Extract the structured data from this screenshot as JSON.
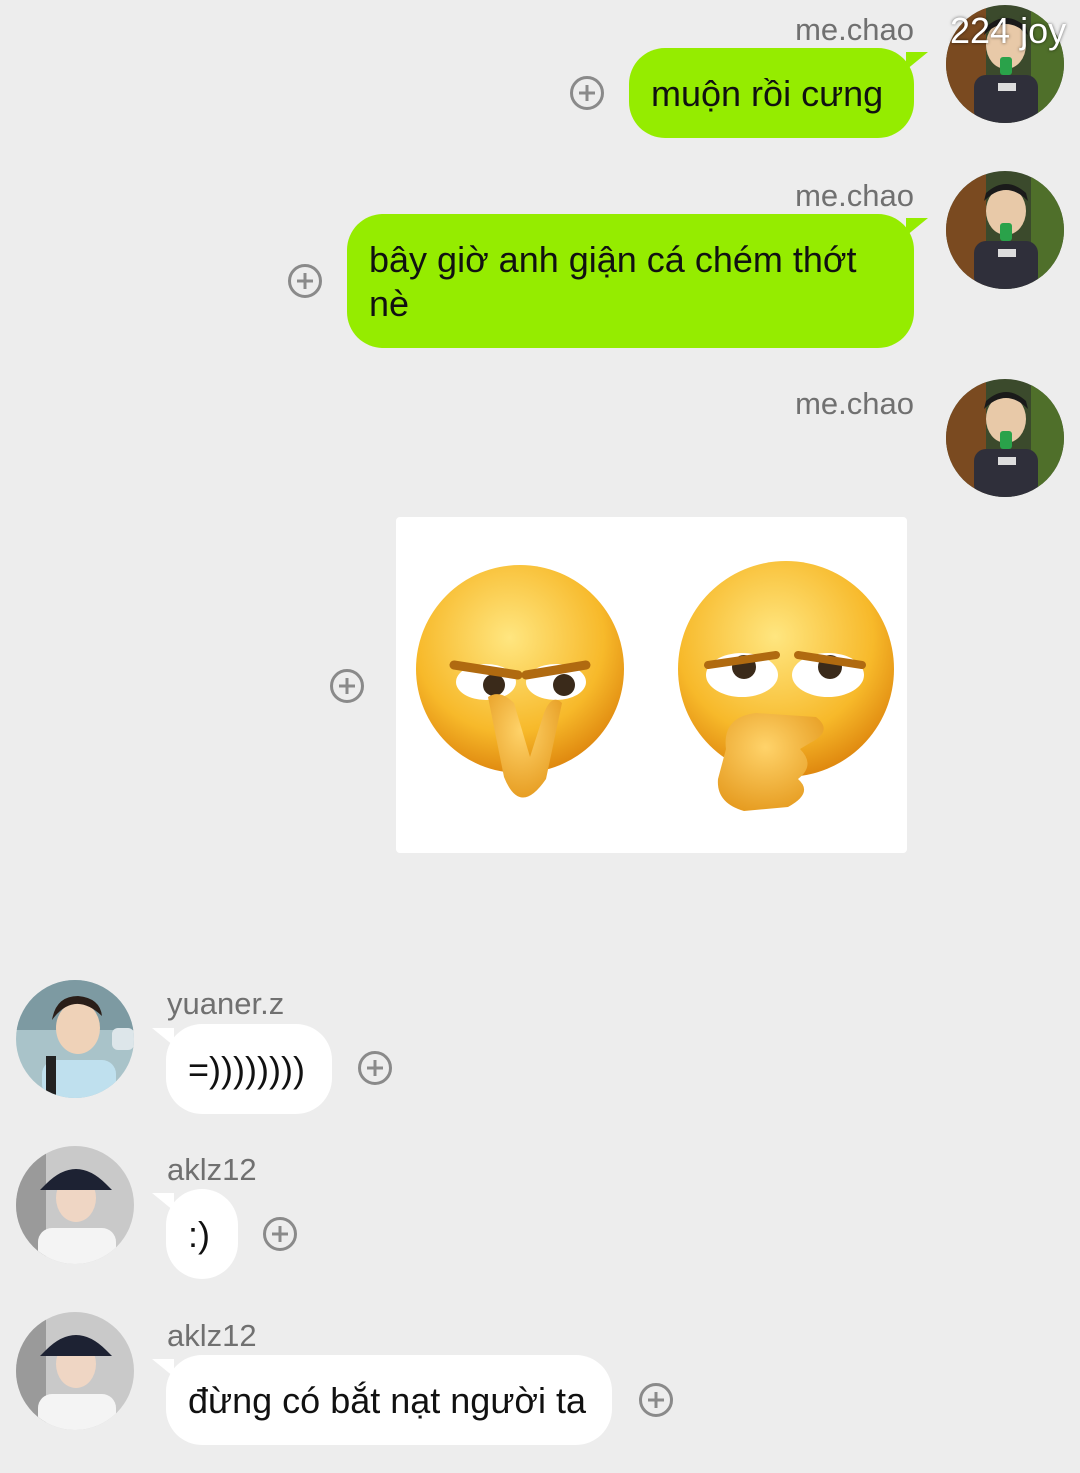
{
  "watermark": "224 joy",
  "messages": [
    {
      "sender": "me.chao",
      "text": "muộn rồi cưng",
      "side": "right"
    },
    {
      "sender": "me.chao",
      "text": "bây giờ anh giận cá chém thớt nè",
      "side": "right"
    },
    {
      "sender": "me.chao",
      "sticker": "two-smirking-emoji-sticker",
      "side": "right"
    },
    {
      "sender": "yuaner.z",
      "text": "=))))))))",
      "side": "left"
    },
    {
      "sender": "aklz12",
      "text": ":)",
      "side": "left"
    },
    {
      "sender": "aklz12",
      "text": "đừng có bắt nạt người ta",
      "side": "left"
    }
  ],
  "colors": {
    "background": "#ededed",
    "sent_bubble": "#95ec00",
    "received_bubble": "#ffffff",
    "name_text": "#707070"
  }
}
